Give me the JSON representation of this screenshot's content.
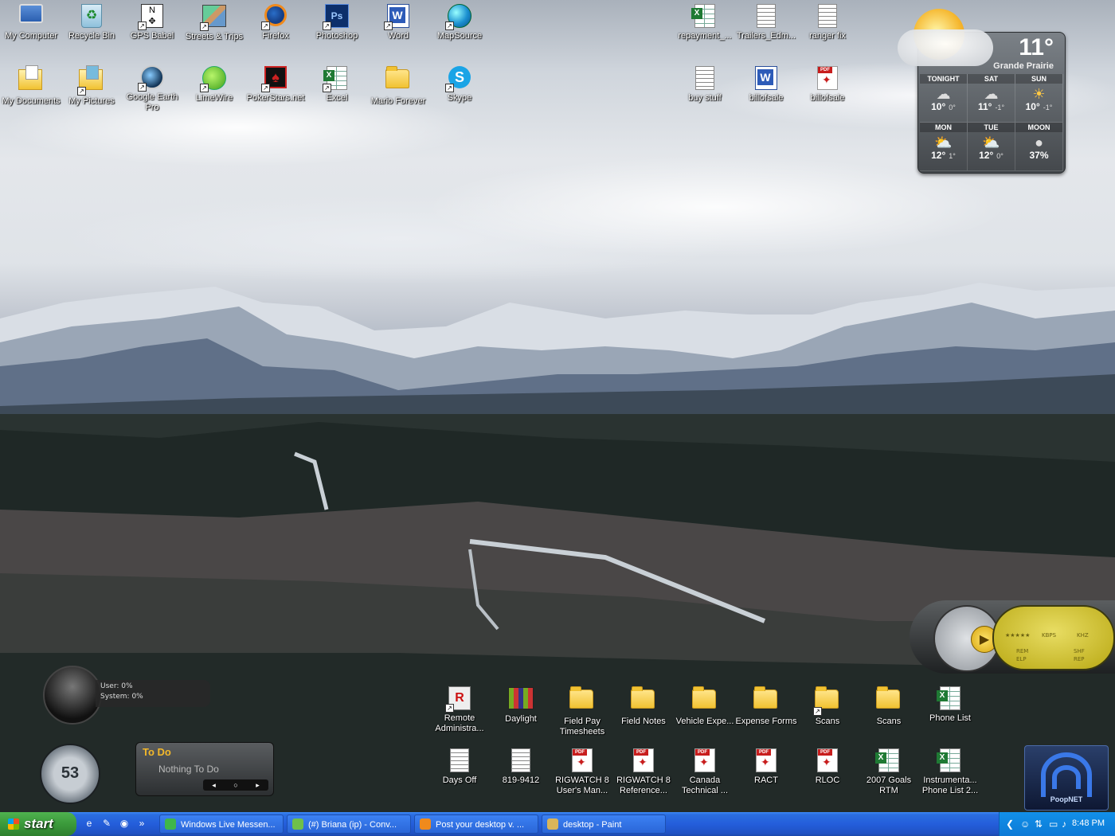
{
  "desktop_icons": {
    "my_computer": "My Computer",
    "recycle_bin": "Recycle Bin",
    "gps_babel": "GPS Babel",
    "streets_trips": "Streets & Trips",
    "firefox": "Firefox",
    "photoshop": "Photoshop",
    "word": "Word",
    "mapsource": "MapSource",
    "repayment": "repayment_...",
    "trailers": "Trailers_Edm...",
    "ranger_fix": "ranger fix",
    "my_documents": "My Documents",
    "my_pictures": "My Pictures",
    "google_earth": "Google Earth Pro",
    "limewire": "LimeWire",
    "pokerstars": "PokerStars.net",
    "excel": "Excel",
    "mario_forever": "Mario Forever",
    "skype": "Skype",
    "buy_stuff": "buy stuff",
    "billofsale_doc": "billofsale",
    "billofsale_pdf": "billofsale",
    "remote_admin": "Remote Administra...",
    "daylight": "Daylight",
    "field_pay": "Field Pay Timesheets",
    "field_notes": "Field Notes",
    "vehicle_expe": "Vehicle Expe...",
    "expense_forms": "Expense Forms",
    "scans_shortcut": "Scans",
    "scans_folder": "Scans",
    "phone_list": "Phone List",
    "days_off": "Days Off",
    "phone_num": "819-9412",
    "rigwatch_user": "RIGWATCH 8 User's Man...",
    "rigwatch_ref": "RIGWATCH 8 Reference...",
    "canada_tech": "Canada Technical ...",
    "ract": "RACT",
    "rloc": "RLOC",
    "goals_2007": "2007 Goals RTM",
    "instrumenta": "Instrumenta... Phone List 2..."
  },
  "weather": {
    "current_temp": "11°",
    "city": "Grande Prairie",
    "forecast": [
      {
        "day": "TONIGHT",
        "icon": "rain-cloud-icon",
        "hi": "10°",
        "lo": "0°"
      },
      {
        "day": "SAT",
        "icon": "rain-cloud-icon",
        "hi": "11°",
        "lo": "-1°"
      },
      {
        "day": "SUN",
        "icon": "sunny-icon",
        "hi": "10°",
        "lo": "-1°"
      },
      {
        "day": "MON",
        "icon": "partly-cloudy-icon",
        "hi": "12°",
        "lo": "1°"
      },
      {
        "day": "TUE",
        "icon": "partly-cloudy-icon",
        "hi": "12°",
        "lo": "0°"
      },
      {
        "day": "MOON",
        "icon": "moon-icon",
        "hi": "37%",
        "lo": ""
      }
    ]
  },
  "media_player": {
    "kbps": "KBPS",
    "khz": "KHZ",
    "rem": "REM",
    "elp": "ELP",
    "shf": "SHF",
    "rep": "REP",
    "stars": "★★★★★"
  },
  "cpu_meter": {
    "user": "User: 0%",
    "system": "System: 0%"
  },
  "dial": {
    "value": "53"
  },
  "todo": {
    "title": "To Do",
    "empty_text": "Nothing To Do"
  },
  "wifi": {
    "label": "PoopNET"
  },
  "taskbar": {
    "start_label": "start",
    "tasks": [
      {
        "label": "Windows Live Messen...",
        "color": "#3fb64a"
      },
      {
        "label": "(#) Briana (ip) - Conv...",
        "color": "#6fc04a"
      },
      {
        "label": "Post your desktop v. ...",
        "color": "#f08a1c"
      },
      {
        "label": "desktop - Paint",
        "color": "#d9b55a"
      }
    ],
    "clock": "8:48 PM"
  }
}
